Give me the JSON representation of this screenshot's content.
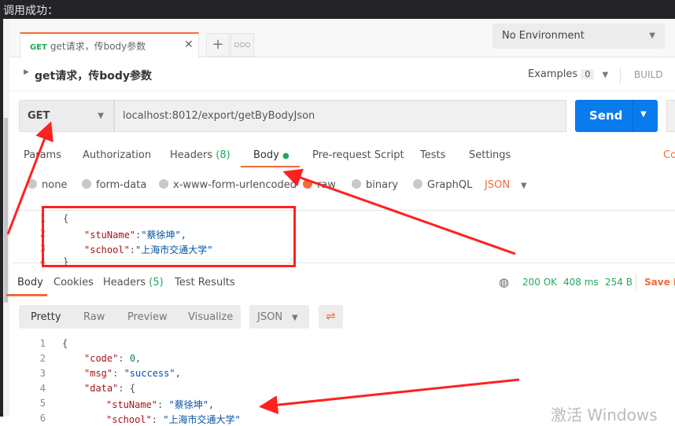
{
  "caption": "调用成功：",
  "tab": {
    "method": "GET",
    "title": "get请求，传body参数",
    "close": "✕",
    "new": "+",
    "more": "○○○"
  },
  "environment": {
    "label": "No Environment"
  },
  "request": {
    "title": "get请求，传body参数",
    "examples_label": "Examples",
    "examples_count": "0",
    "build": "BUILD",
    "method": "GET",
    "url": "localhost:8012/export/getByBodyJson",
    "send": "Send"
  },
  "req_tabs": [
    {
      "label": "Params"
    },
    {
      "label": "Authorization"
    },
    {
      "label": "Headers",
      "count": "(8)"
    },
    {
      "label": "Body"
    },
    {
      "label": "Pre-request Script"
    },
    {
      "label": "Tests"
    },
    {
      "label": "Settings"
    },
    {
      "label": "Co"
    }
  ],
  "body_types": [
    "none",
    "form-data",
    "x-www-form-urlencoded",
    "raw",
    "binary",
    "GraphQL"
  ],
  "body_format": "JSON",
  "request_body": [
    {
      "n": "1",
      "t": "{"
    },
    {
      "n": "2",
      "k": "\"stuName\"",
      "v": "\"蔡徐坤\","
    },
    {
      "n": "3",
      "k": "\"school\"",
      "v": "\"上海市交通大学\""
    },
    {
      "n": "4",
      "t": "}"
    }
  ],
  "resp_tabs": [
    {
      "label": "Body"
    },
    {
      "label": "Cookies"
    },
    {
      "label": "Headers",
      "count": "(5)"
    },
    {
      "label": "Test Results"
    }
  ],
  "status": {
    "code": "200 OK",
    "time": "408 ms",
    "size": "254 B",
    "save": "Save R"
  },
  "view_modes": [
    "Pretty",
    "Raw",
    "Preview",
    "Visualize"
  ],
  "resp_format": "JSON",
  "response_lines": [
    {
      "n": "1",
      "t": "{"
    },
    {
      "n": "2",
      "k": "\"code\"",
      "v": "0,",
      "vt": "n"
    },
    {
      "n": "3",
      "k": "\"msg\"",
      "v": "\"success\","
    },
    {
      "n": "4",
      "k": "\"data\"",
      "v": "{"
    },
    {
      "n": "5",
      "k": "\"stuName\"",
      "v": "\"蔡徐坤\","
    },
    {
      "n": "6",
      "k": "\"school\"",
      "v": "\"上海市交通大学\""
    }
  ],
  "watermark": "激活 Windows",
  "colors": {
    "accent": "#f26b3a",
    "send": "#097bed",
    "success": "#26a65b",
    "annotation": "#ff2020"
  }
}
